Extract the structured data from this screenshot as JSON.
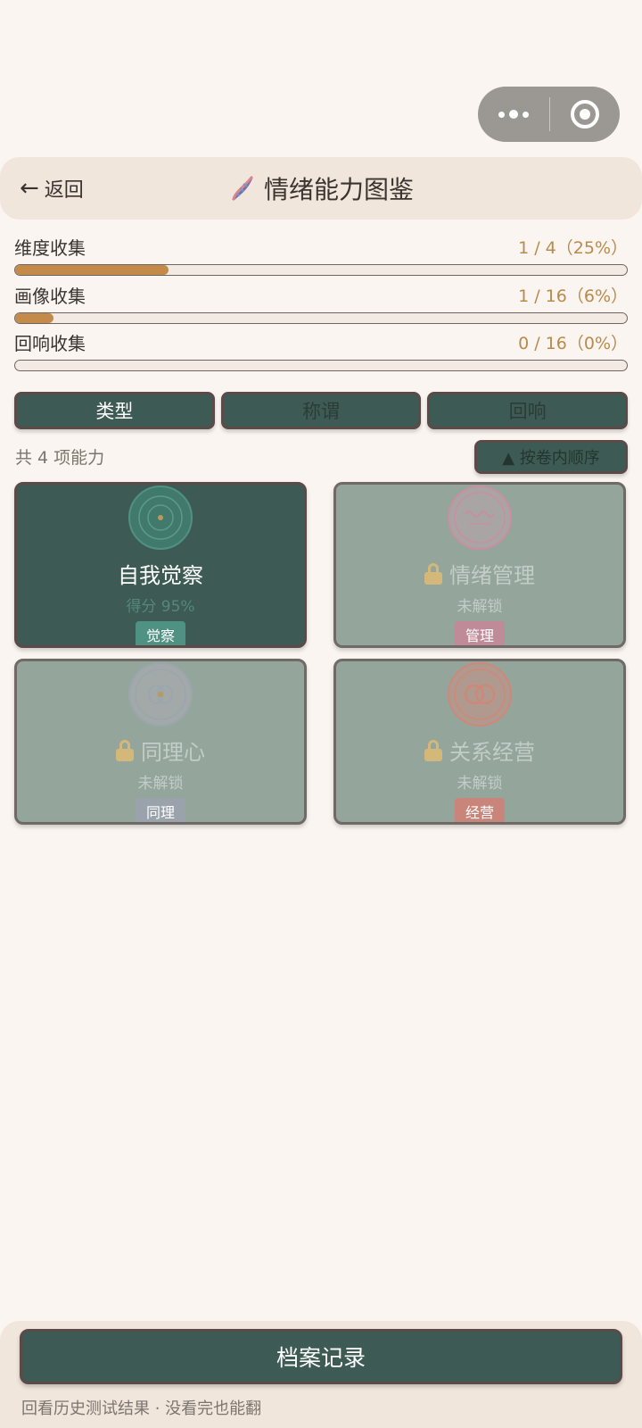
{
  "header": {
    "back_label": "返回",
    "title": "情绪能力图鉴"
  },
  "progress": [
    {
      "label": "维度收集",
      "value": "1 / 4（25%）",
      "fraction": 0.25
    },
    {
      "label": "画像收集",
      "value": "1 / 16（6%）",
      "fraction": 0.0625
    },
    {
      "label": "回响收集",
      "value": "0 / 16（0%）",
      "fraction": 0
    }
  ],
  "tabs": [
    {
      "label": "类型",
      "active": true
    },
    {
      "label": "称谓",
      "active": false
    },
    {
      "label": "回响",
      "active": false
    }
  ],
  "list": {
    "count_text": "共 4 项能力",
    "sort_label": "▲ 按卷内顺序"
  },
  "cards": [
    {
      "name": "自我觉察",
      "sub": "得分 95%",
      "badge": "觉察",
      "locked": false,
      "icon": "concentric-circles-icon",
      "badge_color": "#4f9283",
      "emblem_color": "#4f9283"
    },
    {
      "name": "情绪管理",
      "sub": "未解锁",
      "badge": "管理",
      "locked": true,
      "icon": "wave-icon",
      "badge_color": "#c08b98",
      "emblem_color": "#c98fa0"
    },
    {
      "name": "同理心",
      "sub": "未解锁",
      "badge": "同理",
      "locked": true,
      "icon": "heart-circle-icon",
      "badge_color": "#9aa3ab",
      "emblem_color": "#9aa6ae"
    },
    {
      "name": "关系经营",
      "sub": "未解锁",
      "badge": "经营",
      "locked": true,
      "icon": "linked-rings-icon",
      "badge_color": "#c9857a",
      "emblem_color": "#cf8878"
    }
  ],
  "footer": {
    "records_label": "档案记录",
    "hint": "回看历史测试结果 · 没看完也能翻"
  }
}
